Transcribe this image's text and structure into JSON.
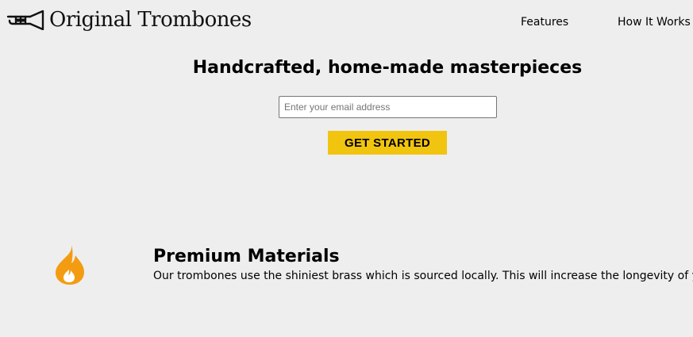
{
  "header": {
    "logo_text": "Original Trombones",
    "logo_icon": "trombone-icon",
    "nav": [
      {
        "label": "Features"
      },
      {
        "label": "How It Works"
      }
    ]
  },
  "hero": {
    "title": "Handcrafted, home-made masterpieces",
    "email": {
      "placeholder": "Enter your email address",
      "value": ""
    },
    "cta_label": "GET STARTED"
  },
  "features": [
    {
      "icon": "fire-icon",
      "title": "Premium Materials",
      "description": "Our trombones use the shiniest brass which is sourced locally. This will increase the longevity of your purchase."
    }
  ],
  "colors": {
    "background": "#eeeeee",
    "cta": "#f1c40f",
    "flame": "#f39c12"
  }
}
